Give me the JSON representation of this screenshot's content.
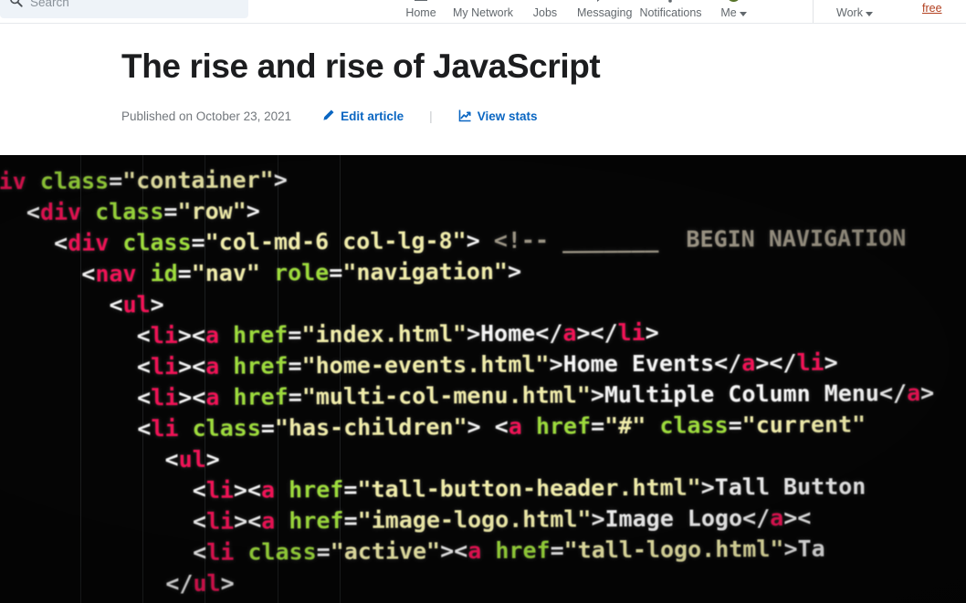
{
  "nav": {
    "search": {
      "placeholder": "Search",
      "icon": "search-icon"
    },
    "items": [
      {
        "label": "Home",
        "icon": "home-icon"
      },
      {
        "label": "My Network",
        "icon": "people-icon"
      },
      {
        "label": "Jobs",
        "icon": "briefcase-icon"
      },
      {
        "label": "Messaging",
        "icon": "message-icon"
      },
      {
        "label": "Notifications",
        "icon": "bell-icon"
      },
      {
        "label": "Me",
        "icon": "avatar-icon",
        "has_caret": true
      }
    ],
    "work": {
      "label": "Work",
      "has_caret": true
    },
    "free_link": "free"
  },
  "article": {
    "title": "The rise and rise of JavaScript",
    "published": "Published on October 23, 2021",
    "edit_label": "Edit article",
    "edit_icon": "pencil-icon",
    "separator": "|",
    "stats_label": "View stats",
    "stats_icon": "line-chart-icon",
    "accent_color": "#0a66c2"
  },
  "hero": {
    "alt": "photograph of an out-of-focus computer screen showing HTML navigation markup",
    "background_color": "#050505",
    "colors": {
      "tag": "#f01356",
      "attribute": "#9ddb3c",
      "string": "#f0ecaa",
      "punctuation": "#f2f2f2",
      "text": "#f5f5f5",
      "comment": "#9b9484"
    },
    "code_lines": [
      {
        "indent": 0,
        "segments": [
          {
            "t": "tag",
            "v": "iv"
          },
          {
            "t": "punc",
            "v": " "
          },
          {
            "t": "attr",
            "v": "class"
          },
          {
            "t": "punc",
            "v": "="
          },
          {
            "t": "str",
            "v": "\"container\""
          },
          {
            "t": "punc",
            "v": ">"
          }
        ]
      },
      {
        "indent": 1,
        "segments": [
          {
            "t": "punc",
            "v": "<"
          },
          {
            "t": "tag",
            "v": "div"
          },
          {
            "t": "punc",
            "v": " "
          },
          {
            "t": "attr",
            "v": "class"
          },
          {
            "t": "punc",
            "v": "="
          },
          {
            "t": "str",
            "v": "\"row\""
          },
          {
            "t": "punc",
            "v": ">"
          }
        ]
      },
      {
        "indent": 2,
        "segments": [
          {
            "t": "punc",
            "v": "<"
          },
          {
            "t": "tag",
            "v": "div"
          },
          {
            "t": "punc",
            "v": " "
          },
          {
            "t": "attr",
            "v": "class"
          },
          {
            "t": "punc",
            "v": "="
          },
          {
            "t": "str",
            "v": "\"col-md-6 col-lg-8\""
          },
          {
            "t": "punc",
            "v": "> "
          },
          {
            "t": "cmt",
            "v": "<!-- _______  BEGIN NAVIGATION"
          }
        ]
      },
      {
        "indent": 3,
        "segments": [
          {
            "t": "punc",
            "v": "<"
          },
          {
            "t": "tag",
            "v": "nav"
          },
          {
            "t": "punc",
            "v": " "
          },
          {
            "t": "attr",
            "v": "id"
          },
          {
            "t": "punc",
            "v": "="
          },
          {
            "t": "str",
            "v": "\"nav\""
          },
          {
            "t": "punc",
            "v": " "
          },
          {
            "t": "attr",
            "v": "role"
          },
          {
            "t": "punc",
            "v": "="
          },
          {
            "t": "str",
            "v": "\"navigation\""
          },
          {
            "t": "punc",
            "v": ">"
          }
        ]
      },
      {
        "indent": 4,
        "segments": [
          {
            "t": "punc",
            "v": "<"
          },
          {
            "t": "tag",
            "v": "ul"
          },
          {
            "t": "punc",
            "v": ">"
          }
        ]
      },
      {
        "indent": 5,
        "segments": [
          {
            "t": "punc",
            "v": "<"
          },
          {
            "t": "tag",
            "v": "li"
          },
          {
            "t": "punc",
            "v": "><"
          },
          {
            "t": "tag",
            "v": "a"
          },
          {
            "t": "punc",
            "v": " "
          },
          {
            "t": "attr",
            "v": "href"
          },
          {
            "t": "punc",
            "v": "="
          },
          {
            "t": "str",
            "v": "\"index.html\""
          },
          {
            "t": "punc",
            "v": ">"
          },
          {
            "t": "txt",
            "v": "Home"
          },
          {
            "t": "punc",
            "v": "</"
          },
          {
            "t": "tag",
            "v": "a"
          },
          {
            "t": "punc",
            "v": "></"
          },
          {
            "t": "tag",
            "v": "li"
          },
          {
            "t": "punc",
            "v": ">"
          }
        ]
      },
      {
        "indent": 5,
        "segments": [
          {
            "t": "punc",
            "v": "<"
          },
          {
            "t": "tag",
            "v": "li"
          },
          {
            "t": "punc",
            "v": "><"
          },
          {
            "t": "tag",
            "v": "a"
          },
          {
            "t": "punc",
            "v": " "
          },
          {
            "t": "attr",
            "v": "href"
          },
          {
            "t": "punc",
            "v": "="
          },
          {
            "t": "str",
            "v": "\"home-events.html\""
          },
          {
            "t": "punc",
            "v": ">"
          },
          {
            "t": "txt",
            "v": "Home Events"
          },
          {
            "t": "punc",
            "v": "</"
          },
          {
            "t": "tag",
            "v": "a"
          },
          {
            "t": "punc",
            "v": "></"
          },
          {
            "t": "tag",
            "v": "li"
          },
          {
            "t": "punc",
            "v": ">"
          }
        ]
      },
      {
        "indent": 5,
        "segments": [
          {
            "t": "punc",
            "v": "<"
          },
          {
            "t": "tag",
            "v": "li"
          },
          {
            "t": "punc",
            "v": "><"
          },
          {
            "t": "tag",
            "v": "a"
          },
          {
            "t": "punc",
            "v": " "
          },
          {
            "t": "attr",
            "v": "href"
          },
          {
            "t": "punc",
            "v": "="
          },
          {
            "t": "str",
            "v": "\"multi-col-menu.html\""
          },
          {
            "t": "punc",
            "v": ">"
          },
          {
            "t": "txt",
            "v": "Multiple Column Menu"
          },
          {
            "t": "punc",
            "v": "</"
          },
          {
            "t": "tag",
            "v": "a"
          },
          {
            "t": "punc",
            "v": ">"
          }
        ]
      },
      {
        "indent": 5,
        "segments": [
          {
            "t": "punc",
            "v": "<"
          },
          {
            "t": "tag",
            "v": "li"
          },
          {
            "t": "punc",
            "v": " "
          },
          {
            "t": "attr",
            "v": "class"
          },
          {
            "t": "punc",
            "v": "="
          },
          {
            "t": "str",
            "v": "\"has-children\""
          },
          {
            "t": "punc",
            "v": "> <"
          },
          {
            "t": "tag",
            "v": "a"
          },
          {
            "t": "punc",
            "v": " "
          },
          {
            "t": "attr",
            "v": "href"
          },
          {
            "t": "punc",
            "v": "="
          },
          {
            "t": "str",
            "v": "\"#\""
          },
          {
            "t": "punc",
            "v": " "
          },
          {
            "t": "attr",
            "v": "class"
          },
          {
            "t": "punc",
            "v": "="
          },
          {
            "t": "str",
            "v": "\"current\""
          }
        ]
      },
      {
        "indent": 6,
        "segments": [
          {
            "t": "punc",
            "v": "<"
          },
          {
            "t": "tag",
            "v": "ul"
          },
          {
            "t": "punc",
            "v": ">"
          }
        ]
      },
      {
        "indent": 7,
        "segments": [
          {
            "t": "punc",
            "v": "<"
          },
          {
            "t": "tag",
            "v": "li"
          },
          {
            "t": "punc",
            "v": "><"
          },
          {
            "t": "tag",
            "v": "a"
          },
          {
            "t": "punc",
            "v": " "
          },
          {
            "t": "attr",
            "v": "href"
          },
          {
            "t": "punc",
            "v": "="
          },
          {
            "t": "str",
            "v": "\"tall-button-header.html\""
          },
          {
            "t": "punc",
            "v": ">"
          },
          {
            "t": "txt",
            "v": "Tall Button"
          }
        ]
      },
      {
        "indent": 7,
        "segments": [
          {
            "t": "punc",
            "v": "<"
          },
          {
            "t": "tag",
            "v": "li"
          },
          {
            "t": "punc",
            "v": "><"
          },
          {
            "t": "tag",
            "v": "a"
          },
          {
            "t": "punc",
            "v": " "
          },
          {
            "t": "attr",
            "v": "href"
          },
          {
            "t": "punc",
            "v": "="
          },
          {
            "t": "str",
            "v": "\"image-logo.html\""
          },
          {
            "t": "punc",
            "v": ">"
          },
          {
            "t": "txt",
            "v": "Image Logo"
          },
          {
            "t": "punc",
            "v": "</"
          },
          {
            "t": "tag",
            "v": "a"
          },
          {
            "t": "punc",
            "v": "><"
          }
        ]
      },
      {
        "indent": 7,
        "segments": [
          {
            "t": "punc",
            "v": "<"
          },
          {
            "t": "tag",
            "v": "li"
          },
          {
            "t": "punc",
            "v": " "
          },
          {
            "t": "attr",
            "v": "class"
          },
          {
            "t": "punc",
            "v": "="
          },
          {
            "t": "str",
            "v": "\"active\""
          },
          {
            "t": "punc",
            "v": "><"
          },
          {
            "t": "tag",
            "v": "a"
          },
          {
            "t": "punc",
            "v": " "
          },
          {
            "t": "attr",
            "v": "href"
          },
          {
            "t": "punc",
            "v": "="
          },
          {
            "t": "str",
            "v": "\"tall-logo.html\""
          },
          {
            "t": "punc",
            "v": ">"
          },
          {
            "t": "txt",
            "v": "Ta"
          }
        ]
      },
      {
        "indent": 6,
        "segments": [
          {
            "t": "punc",
            "v": "</"
          },
          {
            "t": "tag",
            "v": "ul"
          },
          {
            "t": "punc",
            "v": ">"
          }
        ]
      }
    ]
  }
}
